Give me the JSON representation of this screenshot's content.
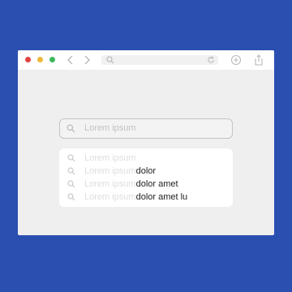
{
  "browser": {
    "traffic_lights": [
      "#e0443e",
      "#f0b83a",
      "#3fb85b"
    ],
    "nav": {
      "back_icon": "chevron-left-icon",
      "forward_icon": "chevron-right-icon"
    },
    "address_bar": {
      "value": "",
      "search_icon": "search-icon",
      "reload_icon": "reload-icon"
    },
    "actions": [
      "add-tab-icon",
      "share-icon"
    ]
  },
  "search": {
    "placeholder": "Lorem ipsum"
  },
  "suggestions": [
    {
      "prefix": "Lorem ipsum",
      "suffix": ""
    },
    {
      "prefix": "Lorem ipsum",
      "suffix": "dolor"
    },
    {
      "prefix": "Lorem ipsum",
      "suffix": "dolor amet"
    },
    {
      "prefix": "Lorem ipsum",
      "suffix": "dolor amet lu"
    }
  ],
  "colors": {
    "background": "#2a4fb0",
    "window": "#efefef",
    "toolbar": "#ffffff"
  }
}
